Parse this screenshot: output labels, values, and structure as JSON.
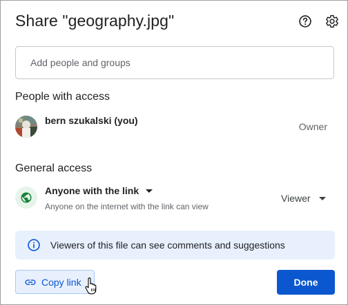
{
  "dialog": {
    "title": "Share \"geography.jpg\"",
    "help_icon": "help-circle-icon",
    "settings_icon": "gear-icon"
  },
  "add_people": {
    "placeholder": "Add people and groups",
    "value": ""
  },
  "people_with_access": {
    "heading": "People with access",
    "people": [
      {
        "name": "bern szukalski (you)",
        "role": "Owner",
        "avatar": "profile-photo"
      }
    ]
  },
  "general_access": {
    "heading": "General access",
    "icon": "globe-icon",
    "selected": "Anyone with the link",
    "description": "Anyone on the internet with the link can view",
    "role": "Viewer"
  },
  "info_banner": {
    "icon": "info-icon",
    "text": "Viewers of this file can see comments and suggestions"
  },
  "footer": {
    "copy_link_label": "Copy link",
    "copy_link_icon": "link-icon",
    "done_label": "Done",
    "cursor": "hand-pointer-cursor"
  },
  "colors": {
    "primary": "#0b57d0",
    "banner_bg": "#e8f0fe",
    "globe_bg": "#e6f4ea",
    "globe_fg": "#188038"
  }
}
